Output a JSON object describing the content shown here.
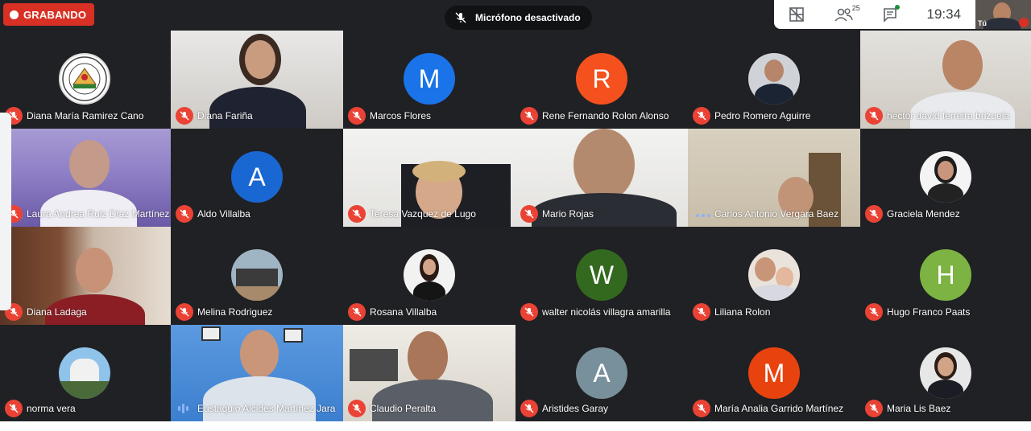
{
  "recording": {
    "label": "GRABANDO"
  },
  "toast": {
    "label": "Micrófono desactivado"
  },
  "top_panel": {
    "participants_count": "25",
    "time": "19:34"
  },
  "self_view": {
    "label": "Tú"
  },
  "colors": {
    "mute_red": "#ea4335",
    "recording_red": "#d93025",
    "grid_bg": "#202124"
  },
  "participants": [
    {
      "name": "Diana María Ramirez Cano",
      "kind": "logo"
    },
    {
      "name": "Diana Fariña",
      "kind": "video"
    },
    {
      "name": "Marcos Flores",
      "kind": "avatar",
      "initial": "M",
      "color": "#1a73e8"
    },
    {
      "name": "Rene Fernando Rolon Alonso",
      "kind": "avatar",
      "initial": "R",
      "color": "#f4511e"
    },
    {
      "name": "Pedro Romero Aguirre",
      "kind": "photo"
    },
    {
      "name": "hector david ferreira brizuela",
      "kind": "video"
    },
    {
      "name": "Laura Andrea Ruiz Díaz Martínez",
      "kind": "video"
    },
    {
      "name": "Aldo Villalba",
      "kind": "avatar",
      "initial": "A",
      "color": "#1967d2"
    },
    {
      "name": "Teresa Vazquez de Lugo",
      "kind": "video"
    },
    {
      "name": "Mario Rojas",
      "kind": "video"
    },
    {
      "name": "Carlos Antonio Vergara Baez",
      "kind": "video"
    },
    {
      "name": "Graciela Mendez",
      "kind": "photo"
    },
    {
      "name": "Diana Ladaga",
      "kind": "video"
    },
    {
      "name": "Melina Rodriguez",
      "kind": "photo"
    },
    {
      "name": "Rosana Villalba",
      "kind": "photo"
    },
    {
      "name": "walter nicolás villagra amarilla",
      "kind": "avatar",
      "initial": "W",
      "color": "#33691e"
    },
    {
      "name": "Liliana Rolon",
      "kind": "photo"
    },
    {
      "name": "Hugo Franco Paats",
      "kind": "avatar",
      "initial": "H",
      "color": "#7cb342"
    },
    {
      "name": "norma vera",
      "kind": "photo"
    },
    {
      "name": "Eustaquio Alcides Martínez Jara",
      "kind": "video"
    },
    {
      "name": "Claudio Peralta",
      "kind": "video"
    },
    {
      "name": "Aristides Garay",
      "kind": "avatar",
      "initial": "A",
      "color": "#78909c"
    },
    {
      "name": "María Analia Garrido Martínez",
      "kind": "avatar",
      "initial": "M",
      "color": "#e8430f"
    },
    {
      "name": "Maria Lis Baez",
      "kind": "photo"
    }
  ]
}
